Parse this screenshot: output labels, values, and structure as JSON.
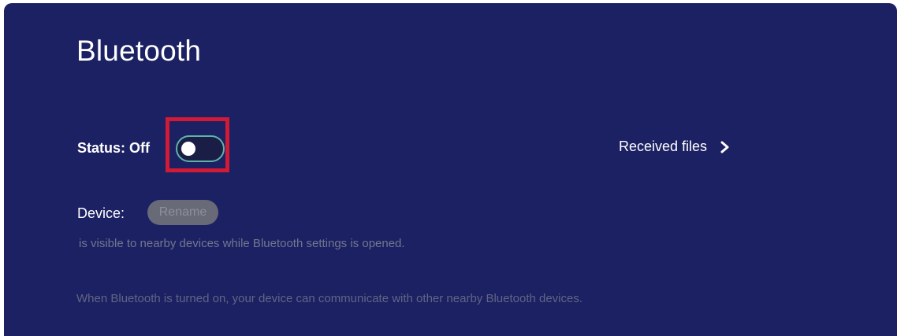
{
  "page": {
    "title": "Bluetooth"
  },
  "status": {
    "label": "Status: Off",
    "toggle_on": false
  },
  "received_files": {
    "label": "Received files",
    "icon": "chevron-right-icon"
  },
  "device": {
    "label": "Device:",
    "rename_label": "Rename",
    "rename_enabled": false,
    "visibility_note": "is visible to nearby devices while Bluetooth settings is opened."
  },
  "info": {
    "text": "When Bluetooth is turned on, your device can communicate with other nearby Bluetooth devices."
  },
  "colors": {
    "background": "#1c2163",
    "highlight": "#d11a35",
    "toggle_border": "#5fb4a8"
  }
}
